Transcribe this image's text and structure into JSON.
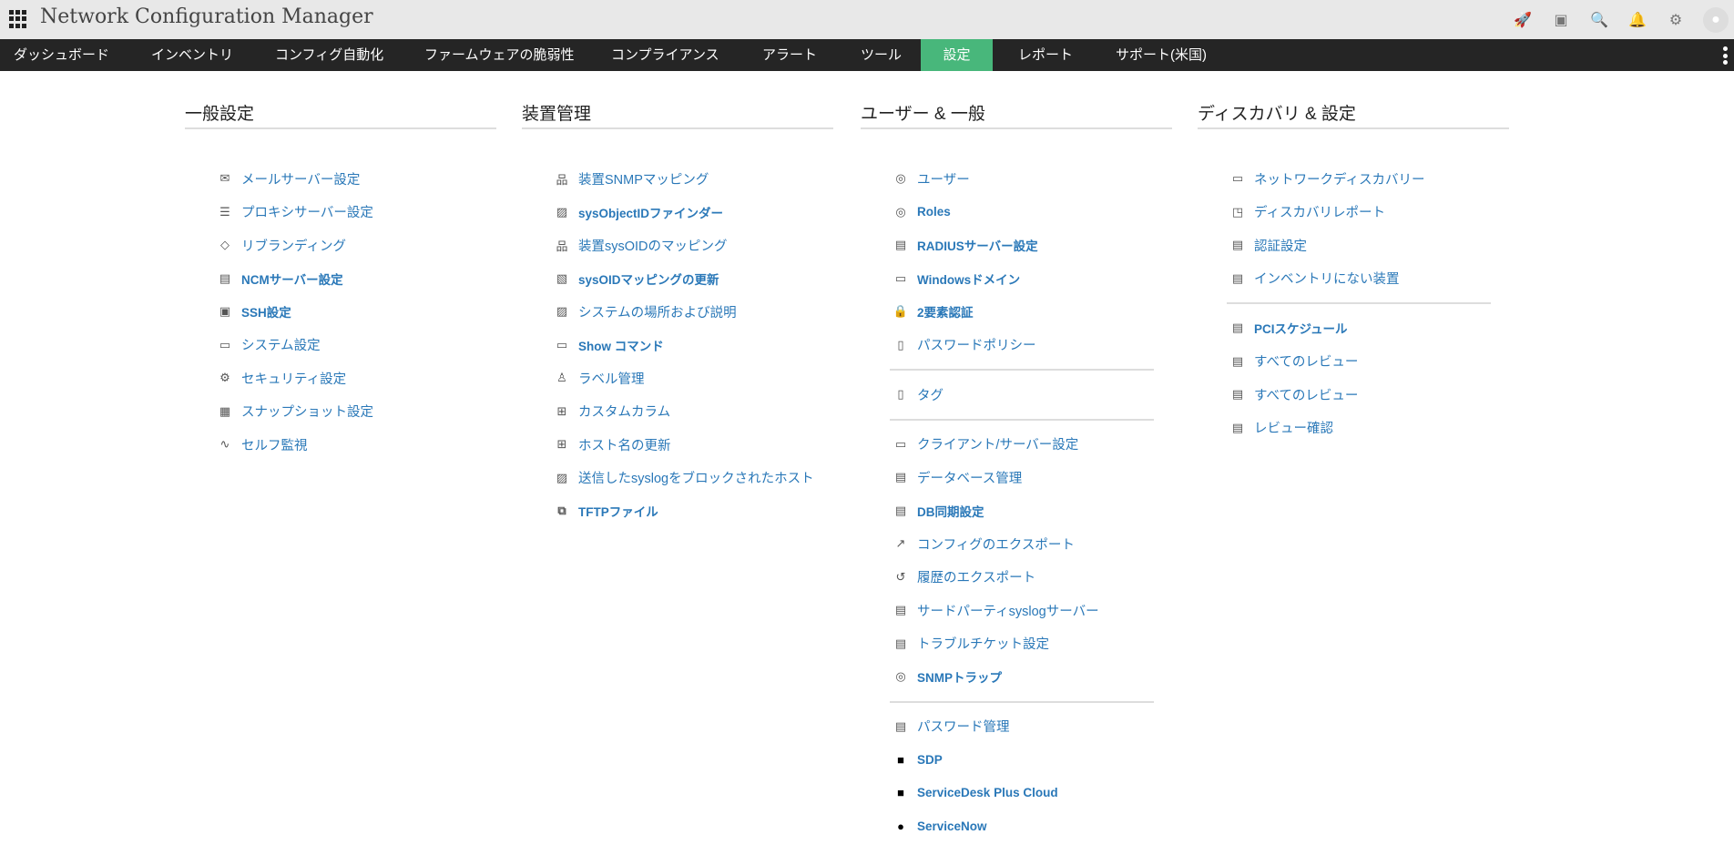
{
  "header": {
    "title": "Network Configuration Manager",
    "icons": [
      "rocket-icon",
      "presentation-icon",
      "search-icon",
      "bell-icon",
      "gear-icon",
      "user-avatar-icon"
    ]
  },
  "nav": {
    "tabs": [
      "ダッシュボード",
      "インベントリ",
      "コンフィグ自動化",
      "ファームウェアの脆弱性",
      "コンプライアンス",
      "アラート",
      "ツール",
      "設定",
      "レポート",
      "サポート(米国)"
    ],
    "active": "設定"
  },
  "colors": {
    "accent": "#48b77b",
    "link": "#2a78b8",
    "nav_bg": "#252525"
  },
  "columns": [
    {
      "title": "一般設定",
      "groups": [
        [
          "メールサーバー設定",
          "プロキシサーバー設定",
          "リブランディング",
          "NCMサーバー設定",
          "SSH設定",
          "システム設定",
          "セキュリティ設定",
          "スナップショット設定",
          "セルフ監視"
        ]
      ]
    },
    {
      "title": "装置管理",
      "groups": [
        [
          "装置SNMPマッピング",
          "sysObjectIDファインダー",
          "装置sysOIDのマッピング",
          "sysOIDマッピングの更新",
          "システムの場所および説明",
          "Show コマンド",
          "ラベル管理",
          "カスタムカラム",
          "ホスト名の更新",
          "送信したsyslogをブロックされたホスト",
          "TFTPファイル"
        ]
      ]
    },
    {
      "title": "ユーザー & 一般",
      "groups": [
        [
          "ユーザー",
          "Roles",
          "RADIUSサーバー設定",
          "Windowsドメイン",
          "2要素認証",
          "パスワードポリシー"
        ],
        [
          "タグ"
        ],
        [
          "クライアント/サーバー設定",
          "データベース管理",
          "DB同期設定",
          "コンフィグのエクスポート",
          "履歴のエクスポート",
          "サードパーティsyslogサーバー",
          "トラブルチケット設定",
          "SNMPトラップ"
        ],
        [
          "パスワード管理",
          "SDP",
          "ServiceDesk Plus Cloud",
          "ServiceNow"
        ]
      ]
    },
    {
      "title": "ディスカバリ & 設定",
      "groups": [
        [
          "ネットワークディスカバリー",
          "ディスカバリレポート",
          "認証設定",
          "インベントリにない装置"
        ],
        [
          "PCIスケジュール",
          "すべてのレビュー",
          "すべてのレビュー",
          "レビュー確認"
        ]
      ]
    }
  ]
}
